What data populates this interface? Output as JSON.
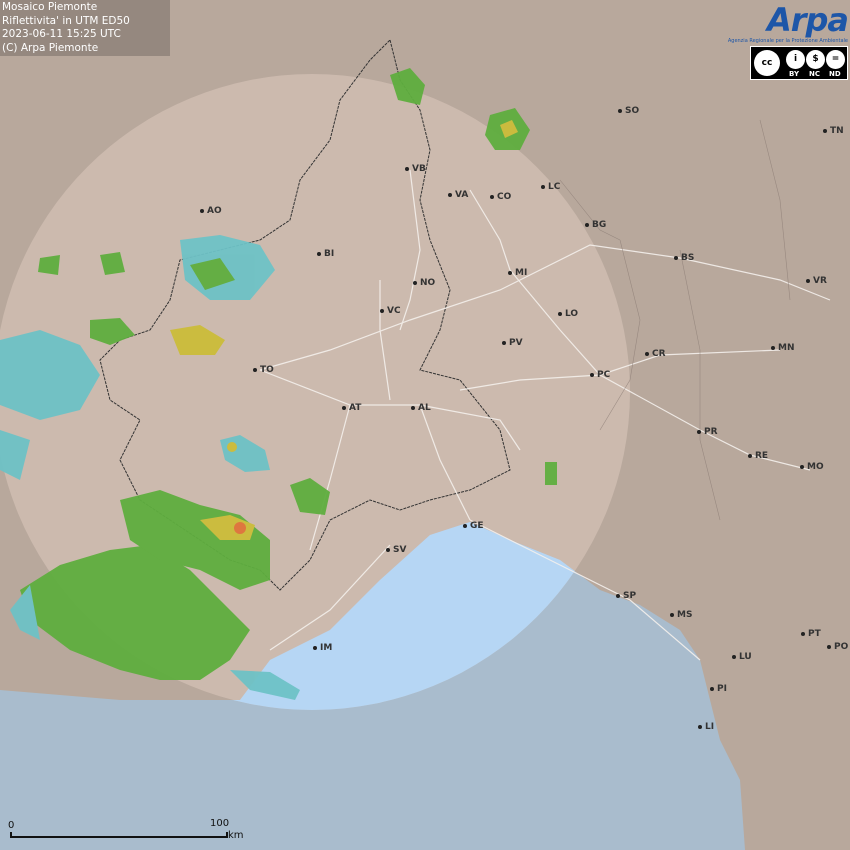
{
  "header": {
    "line1": "Mosaico Piemonte",
    "line2": "Riflettivita' in UTM ED50",
    "line3": "2023-06-11 15:25 UTC",
    "line4": "(C) Arpa Piemonte"
  },
  "logo": {
    "text": "Arpa",
    "subtitle": "Agenzia Regionale per la Protezione Ambientale"
  },
  "license": {
    "labels": [
      "BY",
      "NC",
      "ND"
    ],
    "symbols": [
      "cc",
      "i",
      "$",
      "="
    ]
  },
  "cities": [
    "SO",
    "TN",
    "VB",
    "VA",
    "CO",
    "LC",
    "BG",
    "BS",
    "VR",
    "AO",
    "BI",
    "NO",
    "MI",
    "VC",
    "LO",
    "TO",
    "PV",
    "CR",
    "MN",
    "PC",
    "AT",
    "AL",
    "PR",
    "RE",
    "MO",
    "GE",
    "SV",
    "SP",
    "MS",
    "IM",
    "LU",
    "PT",
    "PO",
    "PI",
    "LI"
  ],
  "scale": {
    "zero": "0",
    "hundred": "100",
    "unit": "km"
  },
  "colors": {
    "land": "#b8a89c",
    "coverage": "#d6c2b8",
    "sea": "#a9bccd",
    "sea_coverage": "#b6d6f4",
    "rain_light": "#6ec2c6",
    "rain_moderate": "#5fae3f",
    "rain_strong": "#cbbd3a",
    "rain_heavy": "#e0743a"
  }
}
